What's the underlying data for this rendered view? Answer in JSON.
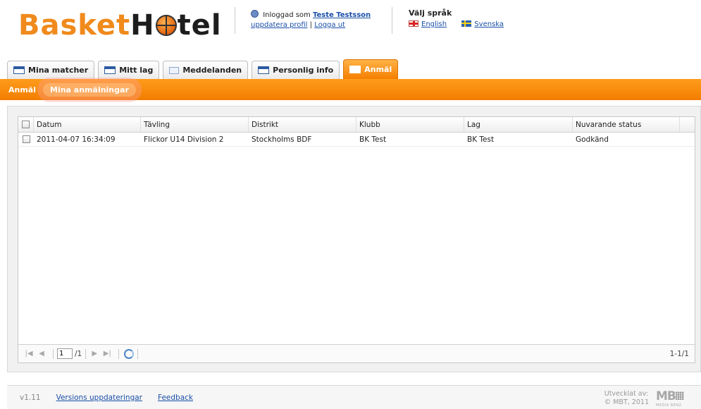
{
  "header": {
    "logo_part1": "Basket",
    "logo_part2_a": "H",
    "logo_part2_b": "tel",
    "logged_in_as": "Inloggad som",
    "user_name": "Teste Testsson",
    "update_profile": "uppdatera profil",
    "separator": "|",
    "logout": "Logga ut",
    "language_title": "Välj språk",
    "lang_english": "English",
    "lang_swedish": "Svenska"
  },
  "tabs": [
    {
      "label": "Mina matcher"
    },
    {
      "label": "Mitt lag"
    },
    {
      "label": "Meddelanden"
    },
    {
      "label": "Personlig info"
    },
    {
      "label": "Anmäl"
    }
  ],
  "subnav": {
    "item1": "Anmäl",
    "item2": "Mina anmälningar"
  },
  "grid": {
    "columns": [
      "Datum",
      "Tävling",
      "Distrikt",
      "Klubb",
      "Lag",
      "Nuvarande status"
    ],
    "rows": [
      [
        "2011-04-07 16:34:09",
        "Flickor U14 Division 2",
        "Stockholms BDF",
        "BK Test",
        "BK Test",
        "Godkänd"
      ]
    ]
  },
  "pager": {
    "page_value": "1",
    "of_pages": "/1",
    "count": "1-1/1"
  },
  "footer": {
    "version": "v1.11",
    "updates_link": "Versions uppdateringar",
    "feedback_link": "Feedback",
    "developed_by": "Utvecklat av:",
    "copyright": "© MBT, 2011",
    "mb_logo": "MB",
    "mb_sub": "MEDIA BENZ"
  },
  "colors": {
    "accent_orange": "#f27d00",
    "logo_orange": "#f08a1c",
    "link_blue": "#1a4fa8"
  }
}
